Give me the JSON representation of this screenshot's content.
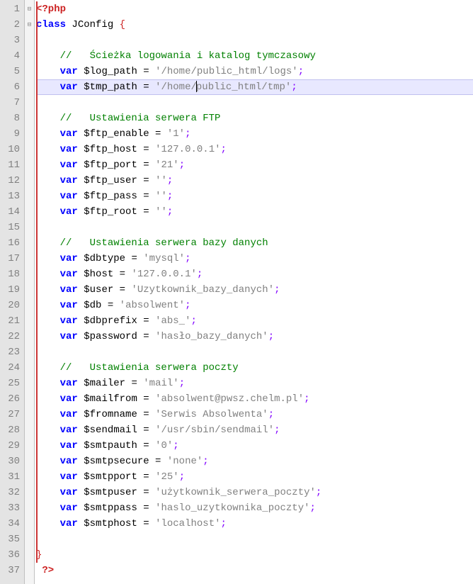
{
  "gutter": [
    "1",
    "2",
    "3",
    "4",
    "5",
    "6",
    "7",
    "8",
    "9",
    "10",
    "11",
    "12",
    "13",
    "14",
    "15",
    "16",
    "17",
    "18",
    "19",
    "20",
    "21",
    "22",
    "23",
    "24",
    "25",
    "26",
    "27",
    "28",
    "29",
    "30",
    "31",
    "32",
    "33",
    "34",
    "35",
    "36",
    "37"
  ],
  "fold": [
    "⊟",
    "⊟",
    "",
    "",
    "",
    "",
    "",
    "",
    "",
    "",
    "",
    "",
    "",
    "",
    "",
    "",
    "",
    "",
    "",
    "",
    "",
    "",
    "",
    "",
    "",
    "",
    "",
    "",
    "",
    "",
    "",
    "",
    "",
    "",
    "",
    "",
    ""
  ],
  "c": {
    "open_tag": "<?php",
    "class_kw": "class",
    "class_name": "JConfig",
    "brace_open": "{",
    "brace_close": "}",
    "comment1": "//   Ścieżka logowania i katalog tymczasowy",
    "comment2": "//   Ustawienia serwera FTP",
    "comment3": "//   Ustawienia serwera bazy danych",
    "comment4": "//   Ustawienia serwera poczty",
    "var": "var",
    "log_path_n": "$log_path",
    "log_path_v": "'/home/public_html/logs'",
    "tmp_path_n": "$tmp_path",
    "tmp_path_v1": "'/home/",
    "tmp_path_v2": "public_html/tmp'",
    "ftp_enable_n": "$ftp_enable",
    "ftp_enable_v": "'1'",
    "ftp_host_n": "$ftp_host",
    "ftp_host_v": "'127.0.0.1'",
    "ftp_port_n": "$ftp_port",
    "ftp_port_v": "'21'",
    "ftp_user_n": "$ftp_user",
    "ftp_user_v": "''",
    "ftp_pass_n": "$ftp_pass",
    "ftp_pass_v": "''",
    "ftp_root_n": "$ftp_root",
    "ftp_root_v": "''",
    "dbtype_n": "$dbtype",
    "dbtype_v": "'mysql'",
    "host_n": "$host",
    "host_v": "'127.0.0.1'",
    "user_n": "$user",
    "user_v": "'Uzytkownik_bazy_danych'",
    "db_n": "$db",
    "db_v": "'absolwent'",
    "dbprefix_n": "$dbprefix",
    "dbprefix_v": "'abs_'",
    "password_n": "$password",
    "password_v": "'hasło_bazy_danych'",
    "mailer_n": "$mailer",
    "mailer_v": "'mail'",
    "mailfrom_n": "$mailfrom",
    "mailfrom_v": "'absolwent@pwsz.chelm.pl'",
    "fromname_n": "$fromname",
    "fromname_v": "'Serwis Absolwenta'",
    "sendmail_n": "$sendmail",
    "sendmail_v": "'/usr/sbin/sendmail'",
    "smtpauth_n": "$smtpauth",
    "smtpauth_v": "'0'",
    "smtpsecure_n": "$smtpsecure",
    "smtpsecure_v": "'none'",
    "smtpport_n": "$smtpport",
    "smtpport_v": "'25'",
    "smtpuser_n": "$smtpuser",
    "smtpuser_v": "'użytkownik_serwera_poczty'",
    "smtppass_n": "$smtppass",
    "smtppass_v": "'haslo_uzytkownika_poczty'",
    "smtphost_n": "$smtphost",
    "smtphost_v": "'localhost'",
    "eq": " = ",
    "semi": ";",
    "close_tag": "?>"
  }
}
